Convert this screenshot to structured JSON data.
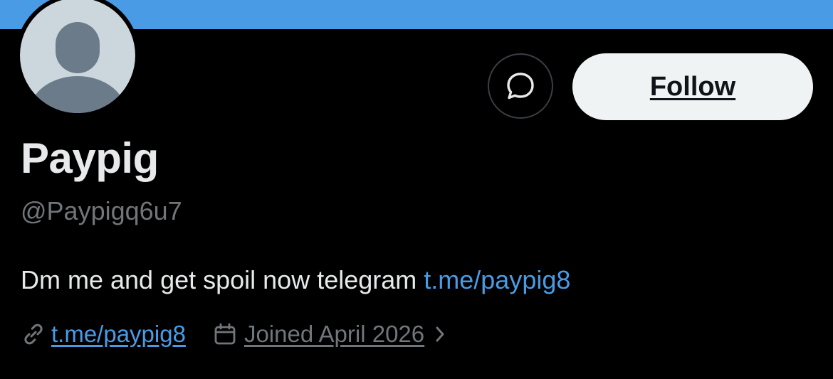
{
  "colors": {
    "banner": "#4a9be6",
    "background": "#000000",
    "avatar_bg": "#ccd6dd",
    "avatar_silhouette": "#6b7b8a",
    "link": "#4a9be6",
    "muted": "#71767b",
    "text": "#e7e9ea",
    "follow_bg": "#eff3f4"
  },
  "profile": {
    "display_name": "Paypig",
    "handle": "@Paypigq6u7",
    "bio_text": "Dm me and get spoil now telegram ",
    "bio_link": "t.me/paypig8",
    "website": "t.me/paypig8",
    "joined": "Joined April 2026"
  },
  "actions": {
    "follow_label": "Follow",
    "message_icon": "message-bubble-icon"
  },
  "icons": {
    "website": "link-icon",
    "joined": "calendar-icon",
    "more": "chevron-right-icon"
  }
}
